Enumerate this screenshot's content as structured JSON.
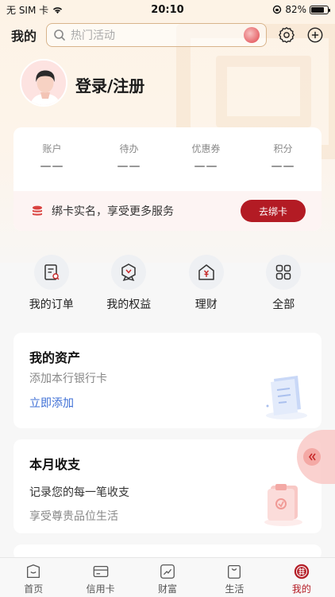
{
  "status_bar": {
    "carrier": "无 SIM 卡",
    "time": "20:10",
    "battery": "82%",
    "battery_level": 0.82
  },
  "header": {
    "title": "我的",
    "search_placeholder": "热门活动"
  },
  "profile": {
    "login_label": "登录/注册"
  },
  "stats": [
    {
      "label": "账户",
      "value": "——"
    },
    {
      "label": "待办",
      "value": "——"
    },
    {
      "label": "优惠券",
      "value": "——"
    },
    {
      "label": "积分",
      "value": "——"
    }
  ],
  "bind_card": {
    "text": "绑卡实名，享受更多服务",
    "button": "去绑卡"
  },
  "quick_links": [
    {
      "label": "我的订单",
      "icon": "order-icon"
    },
    {
      "label": "我的权益",
      "icon": "rights-icon"
    },
    {
      "label": "理财",
      "icon": "wealth-icon"
    },
    {
      "label": "全部",
      "icon": "grid-icon"
    }
  ],
  "assets_card": {
    "title": "我的资产",
    "subtitle": "添加本行银行卡",
    "link": "立即添加"
  },
  "monthly_card": {
    "title": "本月收支",
    "line1": "记录您的每一笔收支",
    "line2": "享受尊贵品位生活"
  },
  "tabbar": [
    {
      "label": "首页",
      "icon": "home-icon",
      "active": false
    },
    {
      "label": "信用卡",
      "icon": "credit-card-icon",
      "active": false
    },
    {
      "label": "财富",
      "icon": "wealth-chart-icon",
      "active": false
    },
    {
      "label": "生活",
      "icon": "shopping-bag-icon",
      "active": false
    },
    {
      "label": "我的",
      "icon": "profile-emblem-icon",
      "active": true
    }
  ],
  "colors": {
    "accent": "#b31b24",
    "link": "#3e6fd6"
  }
}
